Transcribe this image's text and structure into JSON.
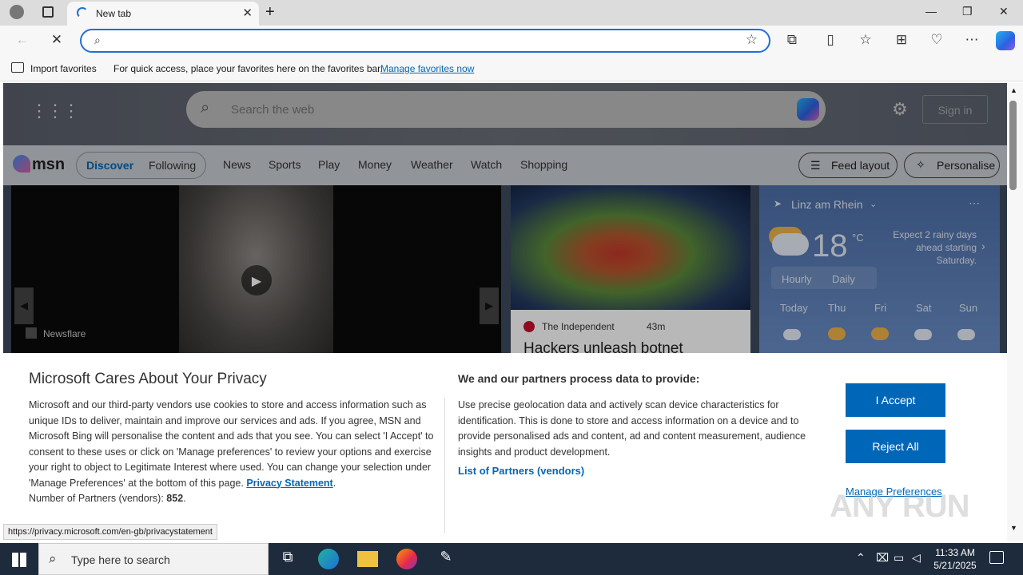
{
  "browser": {
    "tab_title": "New tab",
    "address_value": "",
    "favorites_bar": {
      "import_label": "Import favorites",
      "message": "For quick access, place your favorites here on the favorites bar.",
      "manage_link": "Manage favorites now"
    }
  },
  "msn": {
    "search_placeholder": "Search the web",
    "sign_in": "Sign in",
    "logo": "msn",
    "tabs": [
      "Discover",
      "Following"
    ],
    "nav": [
      "News",
      "Sports",
      "Play",
      "Money",
      "Weather",
      "Watch",
      "Shopping"
    ],
    "feed_layout": "Feed layout",
    "personalise": "Personalise",
    "video_card": {
      "source": "Newsflare"
    },
    "news_card": {
      "source": "The Independent",
      "age": "43m",
      "headline": "Hackers unleash botnet"
    },
    "weather": {
      "location": "Linz am Rhein",
      "temp": "18",
      "unit": "°C",
      "summary": "Expect 2 rainy days ahead starting Saturday.",
      "tabs": [
        "Hourly",
        "Daily"
      ],
      "days": [
        "Today",
        "Thu",
        "Fri",
        "Sat",
        "Sun"
      ]
    }
  },
  "privacy": {
    "title": "Microsoft Cares About Your Privacy",
    "body": "Microsoft and our third-party vendors use cookies to store and access information such as unique IDs to deliver, maintain and improve our services and ads. If you agree, MSN and Microsoft Bing will personalise the content and ads that you see. You can select 'I Accept' to consent to these uses or click on 'Manage preferences' to review your options and exercise your right to object to Legitimate Interest where used. You can change your selection under 'Manage Preferences' at the bottom of this page.",
    "privacy_link": "Privacy Statement",
    "partners_label": "Number of Partners (vendors):",
    "partners_count": "852",
    "right_title": "We and our partners process data to provide:",
    "right_body": "Use precise geolocation data and actively scan device characteristics for identification. This is done to store and access information on a device and to provide personalised ads and content, ad and content measurement, audience insights and product development.",
    "partners_link": "List of Partners (vendors)",
    "accept": "I Accept",
    "reject": "Reject All",
    "manage": "Manage Preferences"
  },
  "status_url": "https://privacy.microsoft.com/en-gb/privacystatement",
  "watermark": "ANY RUN",
  "taskbar": {
    "search_placeholder": "Type here to search",
    "time": "11:33 AM",
    "date": "5/21/2025"
  }
}
